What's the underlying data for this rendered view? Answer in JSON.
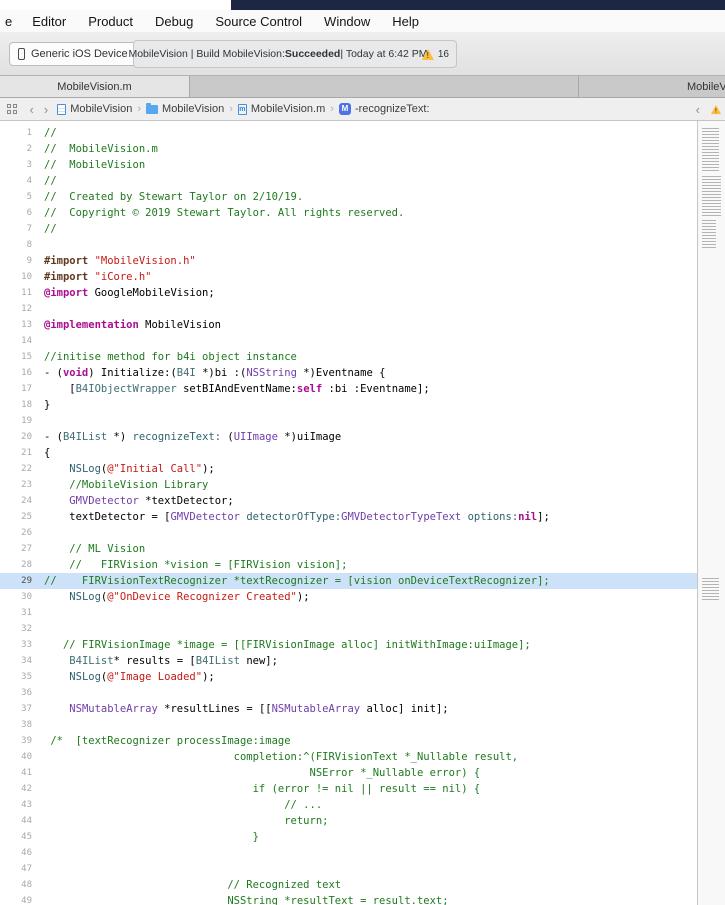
{
  "menu": {
    "items": [
      "e",
      "Editor",
      "Product",
      "Debug",
      "Source Control",
      "Window",
      "Help"
    ]
  },
  "toolbar": {
    "scheme_label": "Generic iOS Device",
    "activity": {
      "prefix": "MobileVision | Build MobileVision: ",
      "status": "Succeeded",
      "suffix": " | Today at 6:42 PM",
      "warning_count": "16"
    }
  },
  "tabbar": {
    "active_tab": "MobileVision.m",
    "right_pane_tab": "MobileVision.m"
  },
  "jumpbar": {
    "back": "‹",
    "forward": "›",
    "separator": "›",
    "crumbs": [
      {
        "icon": "project-file-icon",
        "label": "MobileVision",
        "badge": ""
      },
      {
        "icon": "folder-icon",
        "label": "MobileVision",
        "badge": ""
      },
      {
        "icon": "m-file-icon",
        "label": "MobileVision.m",
        "badge": "m"
      },
      {
        "icon": "method-icon",
        "label": "-recognizeText:",
        "badge": "M"
      }
    ],
    "right_pane_back": "‹"
  },
  "editor": {
    "language": "objective-c",
    "highlight_line": 29,
    "lines": [
      {
        "n": 1,
        "t": [
          [
            "c",
            "//"
          ]
        ]
      },
      {
        "n": 2,
        "t": [
          [
            "c",
            "//  MobileVision.m"
          ]
        ]
      },
      {
        "n": 3,
        "t": [
          [
            "c",
            "//  MobileVision"
          ]
        ]
      },
      {
        "n": 4,
        "t": [
          [
            "c",
            "//"
          ]
        ]
      },
      {
        "n": 5,
        "t": [
          [
            "c",
            "//  Created by Stewart Taylor on 2/10/19."
          ]
        ]
      },
      {
        "n": 6,
        "t": [
          [
            "c",
            "//  Copyright © 2019 Stewart Taylor. All rights reserved."
          ]
        ]
      },
      {
        "n": 7,
        "t": [
          [
            "c",
            "//"
          ]
        ]
      },
      {
        "n": 8,
        "t": []
      },
      {
        "n": 9,
        "t": [
          [
            "p",
            "#import "
          ],
          [
            "s",
            "\"MobileVision.h\""
          ]
        ]
      },
      {
        "n": 10,
        "t": [
          [
            "p",
            "#import "
          ],
          [
            "s",
            "\"iCore.h\""
          ]
        ]
      },
      {
        "n": 11,
        "t": [
          [
            "k",
            "@import"
          ],
          [
            "d",
            " GoogleMobileVision;"
          ]
        ]
      },
      {
        "n": 12,
        "t": []
      },
      {
        "n": 13,
        "t": [
          [
            "k",
            "@implementation"
          ],
          [
            "d",
            " MobileVision"
          ]
        ]
      },
      {
        "n": 14,
        "t": []
      },
      {
        "n": 15,
        "t": [
          [
            "c",
            "//initise method for b4i object instance"
          ]
        ]
      },
      {
        "n": 16,
        "t": [
          [
            "d",
            "- ("
          ],
          [
            "k",
            "void"
          ],
          [
            "d",
            ") Initialize:("
          ],
          [
            "t",
            "B4I"
          ],
          [
            "d",
            " *)bi :("
          ],
          [
            "y",
            "NSString"
          ],
          [
            "d",
            " *)Eventname {"
          ]
        ]
      },
      {
        "n": 17,
        "t": [
          [
            "d",
            "    ["
          ],
          [
            "t",
            "B4IObjectWrapper"
          ],
          [
            "d",
            " setBIAndEventName:"
          ],
          [
            "k",
            "self"
          ],
          [
            "d",
            " :bi :Eventname];"
          ]
        ]
      },
      {
        "n": 18,
        "t": [
          [
            "d",
            "}"
          ]
        ]
      },
      {
        "n": 19,
        "t": []
      },
      {
        "n": 20,
        "t": [
          [
            "d",
            "- ("
          ],
          [
            "t",
            "B4IList"
          ],
          [
            "d",
            " *) "
          ],
          [
            "f",
            "recognizeText:"
          ],
          [
            "d",
            " ("
          ],
          [
            "y",
            "UIImage"
          ],
          [
            "d",
            " *)uiImage"
          ]
        ]
      },
      {
        "n": 21,
        "t": [
          [
            "d",
            "{"
          ]
        ]
      },
      {
        "n": 22,
        "t": [
          [
            "d",
            "    "
          ],
          [
            "f",
            "NSLog"
          ],
          [
            "d",
            "("
          ],
          [
            "s",
            "@\"Initial Call\""
          ],
          [
            "d",
            ");"
          ]
        ]
      },
      {
        "n": 23,
        "t": [
          [
            "c",
            "    //MobileVision Library"
          ]
        ]
      },
      {
        "n": 24,
        "t": [
          [
            "d",
            "    "
          ],
          [
            "y",
            "GMVDetector"
          ],
          [
            "d",
            " *textDetector;"
          ]
        ]
      },
      {
        "n": 25,
        "t": [
          [
            "d",
            "    textDetector = ["
          ],
          [
            "y",
            "GMVDetector"
          ],
          [
            "d",
            " "
          ],
          [
            "f",
            "detectorOfType:"
          ],
          [
            "y",
            "GMVDetectorTypeText"
          ],
          [
            "d",
            " "
          ],
          [
            "f",
            "options:"
          ],
          [
            "k",
            "nil"
          ],
          [
            "d",
            "];"
          ]
        ]
      },
      {
        "n": 26,
        "t": []
      },
      {
        "n": 27,
        "t": [
          [
            "c",
            "    // ML Vision"
          ]
        ]
      },
      {
        "n": 28,
        "t": [
          [
            "c",
            "    //   FIRVision *vision = [FIRVision vision];"
          ]
        ]
      },
      {
        "n": 29,
        "t": [
          [
            "c",
            "//    FIRVisionTextRecognizer *textRecognizer = [vision onDeviceTextRecognizer];"
          ]
        ]
      },
      {
        "n": 30,
        "t": [
          [
            "d",
            "    "
          ],
          [
            "f",
            "NSLog"
          ],
          [
            "d",
            "("
          ],
          [
            "s",
            "@\"OnDevice Recognizer Created\""
          ],
          [
            "d",
            ");"
          ]
        ]
      },
      {
        "n": 31,
        "t": []
      },
      {
        "n": 32,
        "t": []
      },
      {
        "n": 33,
        "t": [
          [
            "c",
            "   // FIRVisionImage *image = [[FIRVisionImage alloc] initWithImage:uiImage];"
          ]
        ]
      },
      {
        "n": 34,
        "t": [
          [
            "d",
            "    "
          ],
          [
            "t",
            "B4IList"
          ],
          [
            "d",
            "* results = ["
          ],
          [
            "t",
            "B4IList"
          ],
          [
            "d",
            " new];"
          ]
        ]
      },
      {
        "n": 35,
        "t": [
          [
            "d",
            "    "
          ],
          [
            "f",
            "NSLog"
          ],
          [
            "d",
            "("
          ],
          [
            "s",
            "@\"Image Loaded\""
          ],
          [
            "d",
            ");"
          ]
        ]
      },
      {
        "n": 36,
        "t": []
      },
      {
        "n": 37,
        "t": [
          [
            "d",
            "    "
          ],
          [
            "y",
            "NSMutableArray"
          ],
          [
            "d",
            " *resultLines = [["
          ],
          [
            "y",
            "NSMutableArray"
          ],
          [
            "d",
            " alloc] init];"
          ]
        ]
      },
      {
        "n": 38,
        "t": []
      },
      {
        "n": 39,
        "t": [
          [
            "c",
            " /*  [textRecognizer processImage:image"
          ]
        ]
      },
      {
        "n": 40,
        "t": [
          [
            "c",
            "                              completion:^(FIRVisionText *_Nullable result,"
          ]
        ]
      },
      {
        "n": 41,
        "t": [
          [
            "c",
            "                                          NSError *_Nullable error) {"
          ]
        ]
      },
      {
        "n": 42,
        "t": [
          [
            "c",
            "                                 if (error != nil || result == nil) {"
          ]
        ]
      },
      {
        "n": 43,
        "t": [
          [
            "c",
            "                                      // ..."
          ]
        ]
      },
      {
        "n": 44,
        "t": [
          [
            "c",
            "                                      return;"
          ]
        ]
      },
      {
        "n": 45,
        "t": [
          [
            "c",
            "                                 }"
          ]
        ]
      },
      {
        "n": 46,
        "t": []
      },
      {
        "n": 47,
        "t": []
      },
      {
        "n": 48,
        "t": [
          [
            "c",
            "                             // Recognized text"
          ]
        ]
      },
      {
        "n": 49,
        "t": [
          [
            "c",
            "                             NSString *resultText = result.text;"
          ]
        ]
      }
    ]
  }
}
